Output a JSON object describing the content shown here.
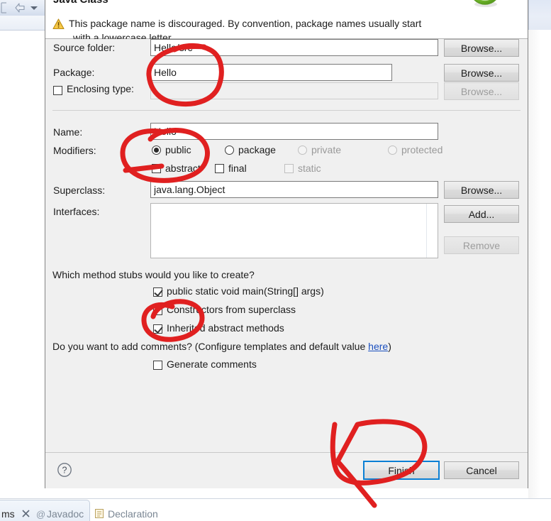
{
  "ide": {
    "toolbar": {
      "back_icon": "back-arrow-icon",
      "dropdown_icon": "chevron-down-icon"
    },
    "bottom_tabs": [
      {
        "label": "ms",
        "icon": "close-x-icon",
        "active": true
      },
      {
        "label": "Javadoc",
        "icon": "at-sign-icon",
        "active": false
      },
      {
        "label": "Declaration",
        "icon": "declaration-icon",
        "active": false
      }
    ]
  },
  "dialog": {
    "title": "Java Class",
    "warning": {
      "icon": "warning-triangle-icon",
      "line1": "This package name is discouraged. By convention, package names usually start",
      "line2": "with a lowercase letter"
    },
    "hero_icon": "java-class-green-c-icon",
    "fields": {
      "source_folder": {
        "label": "Source folder:",
        "value": "Hello/src",
        "button": "Browse...",
        "button_enabled": true
      },
      "package": {
        "label": "Package:",
        "value": "Hello",
        "button": "Browse...",
        "button_enabled": true
      },
      "enclosing_type": {
        "label": "Enclosing type:",
        "value": "",
        "checked": false,
        "enabled": false,
        "button": "Browse...",
        "button_enabled": false
      },
      "name": {
        "label": "Name:",
        "value": "Hello"
      },
      "superclass": {
        "label": "Superclass:",
        "value": "java.lang.Object",
        "button": "Browse...",
        "button_enabled": true
      },
      "interfaces": {
        "label": "Interfaces:",
        "items": [],
        "add_button": "Add...",
        "remove_button": "Remove",
        "remove_enabled": false
      }
    },
    "modifiers": {
      "label": "Modifiers:",
      "access": [
        {
          "label": "public",
          "selected": true,
          "enabled": true
        },
        {
          "label": "package",
          "selected": false,
          "enabled": true
        },
        {
          "label": "private",
          "selected": false,
          "enabled": false
        },
        {
          "label": "protected",
          "selected": false,
          "enabled": false
        }
      ],
      "flags": [
        {
          "label": "abstract",
          "checked": false,
          "enabled": true
        },
        {
          "label": "final",
          "checked": false,
          "enabled": true
        },
        {
          "label": "static",
          "checked": false,
          "enabled": false
        }
      ]
    },
    "method_stubs": {
      "question": "Which method stubs would you like to create?",
      "options": [
        {
          "label": "public static void main(String[] args)",
          "checked": true
        },
        {
          "label": "Constructors from superclass",
          "checked": false
        },
        {
          "label": "Inherited abstract methods",
          "checked": true
        }
      ]
    },
    "comments": {
      "question_prefix": "Do you want to add comments? (Configure templates and default value ",
      "link_text": "here",
      "question_suffix": ")",
      "option": {
        "label": "Generate comments",
        "checked": false
      }
    },
    "footer": {
      "help_icon": "question-mark-help-icon",
      "finish_label": "Finish",
      "cancel_label": "Cancel"
    }
  },
  "annotations": {
    "color": "#e02020",
    "marks": [
      {
        "name": "circle-source-folder-and-package",
        "shape": "ellipse-scribble"
      },
      {
        "name": "circle-name-field",
        "shape": "ellipse-scribble"
      },
      {
        "name": "circle-main-method-checkbox",
        "shape": "ellipse-scribble"
      },
      {
        "name": "circle-finish-button",
        "shape": "loop-with-tail"
      }
    ]
  }
}
